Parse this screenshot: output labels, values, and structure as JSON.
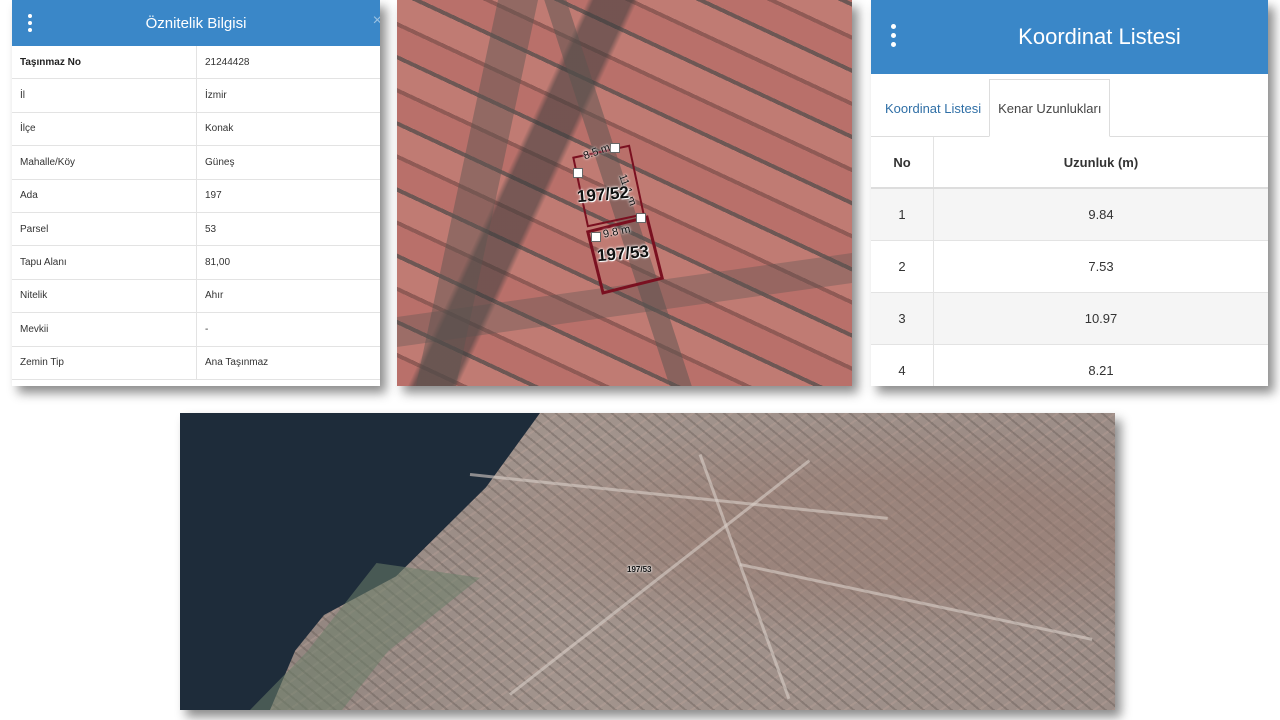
{
  "attribute_panel": {
    "title": "Öznitelik Bilgisi",
    "close_glyph": "×",
    "menu_icon": "vertical-dots-icon",
    "rows": [
      {
        "key": "Taşınmaz No",
        "value": "21244428"
      },
      {
        "key": "İl",
        "value": "İzmir"
      },
      {
        "key": "İlçe",
        "value": "Konak"
      },
      {
        "key": "Mahalle/Köy",
        "value": "Güneş"
      },
      {
        "key": "Ada",
        "value": "197"
      },
      {
        "key": "Parsel",
        "value": "53"
      },
      {
        "key": "Tapu Alanı",
        "value": "81,00"
      },
      {
        "key": "Nitelik",
        "value": "Ahır"
      },
      {
        "key": "Mevkii",
        "value": "-"
      },
      {
        "key": "Zemin Tip",
        "value": "Ana Taşınmaz"
      }
    ]
  },
  "map_crop": {
    "parcel_labels": [
      "197/52",
      "197/53"
    ],
    "length_labels": [
      "8.5 m",
      "11.1 m",
      "9.8 m"
    ]
  },
  "coordinate_panel": {
    "title": "Koordinat Listesi",
    "menu_icon": "vertical-dots-icon",
    "tabs": [
      {
        "label": "Koordinat Listesi",
        "active": false
      },
      {
        "label": "Kenar Uzunlukları",
        "active": true
      }
    ],
    "columns": [
      "No",
      "Uzunluk (m)"
    ],
    "rows": [
      {
        "no": "1",
        "length": "9.84"
      },
      {
        "no": "2",
        "length": "7.53"
      },
      {
        "no": "3",
        "length": "10.97"
      },
      {
        "no": "4",
        "length": "8.21"
      }
    ]
  },
  "overview_map": {
    "parcel_label": "197/53"
  },
  "colors": {
    "header_blue": "#3a87c8",
    "tab_link": "#2f6fa6",
    "parcel_outline": "#7a1020"
  }
}
